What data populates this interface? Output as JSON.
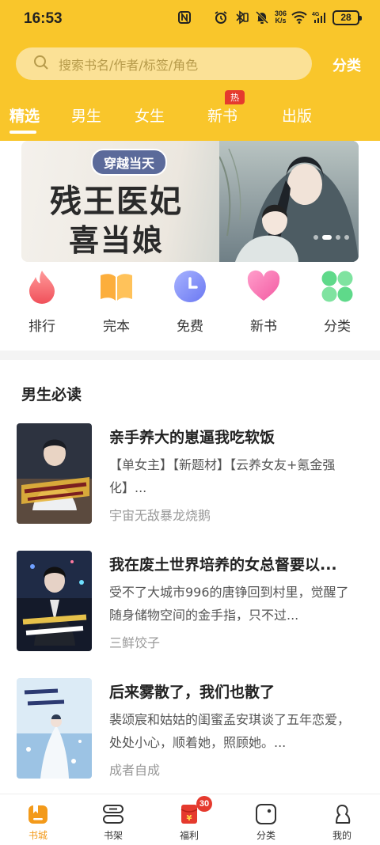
{
  "status_bar": {
    "time": "16:53",
    "net_speed_value": "306",
    "net_speed_unit": "K/s",
    "battery": "28"
  },
  "search": {
    "placeholder": "搜索书名/作者/标签/角色",
    "category_label": "分类"
  },
  "tabs": [
    {
      "label": "精选",
      "active": true
    },
    {
      "label": "男生"
    },
    {
      "label": "女生"
    },
    {
      "label": "新书",
      "badge": "热"
    },
    {
      "label": "出版"
    }
  ],
  "banner": {
    "tag": "穿越当天",
    "title_line1": "残王医妃",
    "title_line2": "喜当娘",
    "slide_count": 5,
    "active_slide": 2
  },
  "quick_nav": [
    {
      "label": "排行",
      "icon": "flame-icon"
    },
    {
      "label": "完本",
      "icon": "open-book-icon"
    },
    {
      "label": "免费",
      "icon": "clock-icon"
    },
    {
      "label": "新书",
      "icon": "heart-icon"
    },
    {
      "label": "分类",
      "icon": "grid-icon"
    }
  ],
  "section": {
    "title": "男生必读"
  },
  "books": [
    {
      "title": "亲手养大的崽逼我吃软饭",
      "desc": "【单女主】【新题材】【云养女友+氪金强化】...",
      "author": "宇宙无敌暴龙烧鹅"
    },
    {
      "title": "我在废土世界培养的女总督要以...",
      "desc": "受不了大城市996的唐铮回到村里，觉醒了随身储物空间的金手指，只不过...",
      "author": "三鲜饺子"
    },
    {
      "title": "后来雾散了，我们也散了",
      "desc": "裴颂宸和姑姑的闺蜜孟安琪谈了五年恋爱，处处小心，顺着她，照顾她。...",
      "author": "成者自成"
    }
  ],
  "bottom_nav": [
    {
      "label": "书城",
      "icon": "bookstore-icon",
      "active": true
    },
    {
      "label": "书架",
      "icon": "bookshelf-icon"
    },
    {
      "label": "福利",
      "icon": "red-envelope-icon",
      "badge": "30"
    },
    {
      "label": "分类",
      "icon": "category-icon"
    },
    {
      "label": "我的",
      "icon": "profile-icon"
    }
  ],
  "colors": {
    "brand_yellow": "#F9C62B",
    "active_orange": "#F39A1A",
    "badge_red": "#E53A2E"
  }
}
